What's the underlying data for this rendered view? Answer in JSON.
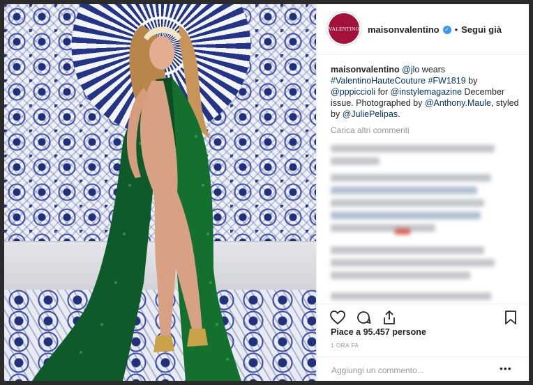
{
  "post": {
    "account": {
      "avatar_text": "VALENTINO",
      "username": "maisonvalentino",
      "verified_icon": "verified-badge-icon",
      "separator": "•",
      "follow_label": "Segui già"
    },
    "caption": {
      "author": "maisonvalentino",
      "parts": [
        {
          "text": "@jlo",
          "link": true
        },
        {
          "text": " wears ",
          "link": false
        },
        {
          "text": "#ValentinoHauteCouture",
          "link": true
        },
        {
          "text": " ",
          "link": false
        },
        {
          "text": "#FW1819",
          "link": true
        },
        {
          "text": " by ",
          "link": false
        },
        {
          "text": "@pppiccioli",
          "link": true
        },
        {
          "text": " for ",
          "link": false
        },
        {
          "text": "@instylemagazine",
          "link": true
        },
        {
          "text": " December issue. Photographed by ",
          "link": false
        },
        {
          "text": "@Anthony.Maule",
          "link": true
        },
        {
          "text": ", styled by ",
          "link": false
        },
        {
          "text": "@JuliePelipas",
          "link": true
        },
        {
          "text": ".",
          "link": false
        }
      ]
    },
    "load_more_comments": "Carica altri commenti",
    "actions": {
      "like_icon": "heart-icon",
      "comment_icon": "comment-icon",
      "share_icon": "share-icon",
      "save_icon": "bookmark-icon"
    },
    "likes_text": "Piace a 95.457 persone",
    "timestamp": "1 ORA FA",
    "composer": {
      "placeholder": "Aggiungi un commento...",
      "more_label": "•••"
    }
  },
  "colors": {
    "link": "#003569",
    "muted": "#999999",
    "text": "#262626",
    "brand": "#a3123a",
    "verified": "#3897f0"
  }
}
